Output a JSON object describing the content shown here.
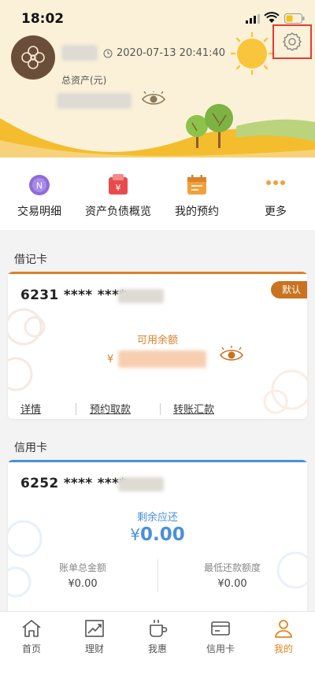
{
  "status_bar": {
    "time": "18:02"
  },
  "header": {
    "login_time": "2020-07-13 20:41:40",
    "total_assets_label": "总资产(元)"
  },
  "quick_menu": [
    {
      "label": "交易明细",
      "icon": "transaction-detail-icon",
      "color": "#8e6cd9"
    },
    {
      "label": "资产负债概览",
      "icon": "asset-overview-icon",
      "color": "#e84b4b"
    },
    {
      "label": "我的预约",
      "icon": "appointment-calendar-icon",
      "color": "#f0a13b"
    },
    {
      "label": "更多",
      "icon": "more-dots-icon",
      "color": "#f0a13b"
    }
  ],
  "debit_section": {
    "title": "借记卡",
    "card_number": "6231 **** ****",
    "default_badge": "默认",
    "balance_label": "可用余额",
    "currency": "¥",
    "links": [
      "详情",
      "预约取款",
      "转账汇款"
    ]
  },
  "credit_section": {
    "title": "信用卡",
    "card_number": "6252 **** ****",
    "remaining_label": "剩余应还",
    "remaining_currency": "¥",
    "remaining_value": "0.00",
    "bill_total_label": "账单总金额",
    "bill_total_value": "¥0.00",
    "min_payment_label": "最低还款额度",
    "min_payment_value": "¥0.00"
  },
  "tabbar": [
    {
      "label": "首页",
      "icon": "home-icon",
      "active": false
    },
    {
      "label": "理财",
      "icon": "finance-chart-icon",
      "active": false
    },
    {
      "label": "我惠",
      "icon": "coffee-cup-icon",
      "active": false
    },
    {
      "label": "信用卡",
      "icon": "credit-card-icon",
      "active": false
    },
    {
      "label": "我的",
      "icon": "person-icon",
      "active": true
    }
  ],
  "colors": {
    "accent_orange": "#e0841e",
    "credit_blue": "#4a90d9",
    "header_bg": "#fbf1d8",
    "settings_highlight": "#e53935"
  }
}
